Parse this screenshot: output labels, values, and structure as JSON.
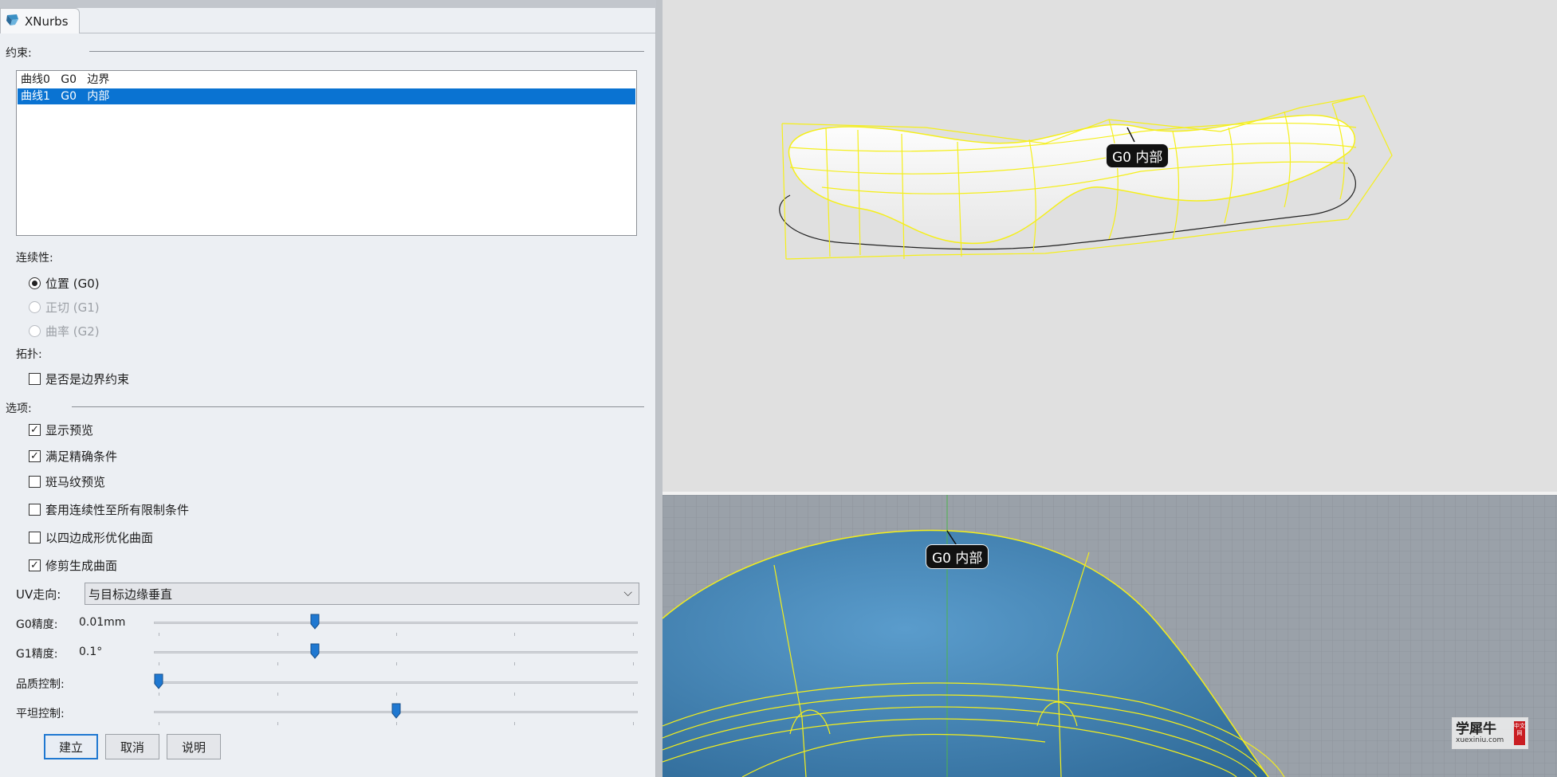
{
  "tab": {
    "title": "XNurbs"
  },
  "constraints": {
    "label": "约束:",
    "items": [
      {
        "text": "曲线0   G0   边界",
        "selected": false
      },
      {
        "text": "曲线1   G0   内部",
        "selected": true
      }
    ]
  },
  "continuity": {
    "label": "连续性:",
    "options": [
      {
        "text": "位置 (G0)",
        "checked": true,
        "enabled": true
      },
      {
        "text": "正切 (G1)",
        "checked": false,
        "enabled": false
      },
      {
        "text": "曲率 (G2)",
        "checked": false,
        "enabled": false
      }
    ]
  },
  "topology": {
    "label": "拓扑:",
    "checkbox": {
      "text": "是否是边界约束",
      "checked": false
    }
  },
  "options": {
    "label": "选项:",
    "items": [
      {
        "text": "显示预览",
        "checked": true
      },
      {
        "text": "满足精确条件",
        "checked": true
      },
      {
        "text": "斑马纹预览",
        "checked": false
      },
      {
        "text": "套用连续性至所有限制条件",
        "checked": false
      },
      {
        "text": "以四边成形优化曲面",
        "checked": false
      },
      {
        "text": "修剪生成曲面",
        "checked": true
      }
    ]
  },
  "uv": {
    "label": "UV走向:",
    "value": "与目标边缘垂直"
  },
  "sliders": [
    {
      "label": "G0精度:",
      "value": "0.01mm",
      "level": 0.33
    },
    {
      "label": "G1精度:",
      "value": "0.1°",
      "level": 0.33
    },
    {
      "label": "品质控制:",
      "value": "",
      "level": 0.0
    },
    {
      "label": "平坦控制:",
      "value": "",
      "level": 0.5
    }
  ],
  "buttons": {
    "create": "建立",
    "cancel": "取消",
    "help": "说明"
  },
  "viewport": {
    "top_label": "G0 内部",
    "bottom_label": "G0 内部"
  },
  "watermark": {
    "main": "学犀牛",
    "url": "xuexiniu.com",
    "badge": "中文网"
  },
  "colors": {
    "selection": "#0a73d2",
    "wireframe": "#f5ef1a",
    "slider_thumb": "#1f78d1",
    "surface_blue": "#3d7fb3"
  }
}
